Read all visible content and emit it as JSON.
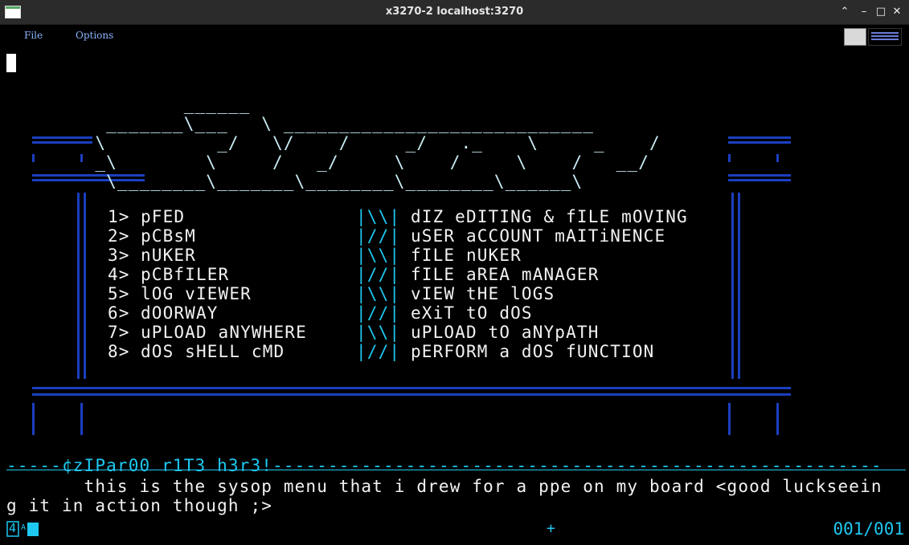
{
  "window": {
    "title": "x3270-2 localhost:3270"
  },
  "menubar": {
    "file": "File",
    "options": "Options"
  },
  "logo": [
    "                ______",
    "         _______\\___   \\ ____________________________",
    "        \\          _/   \\/    /     _/   ._    \\     _    /",
    "        _\\        \\     /   _/     \\    /     \\    /   __/",
    "         \\________\\_______\\________\\________\\______\\"
  ],
  "menu_items": [
    {
      "num": "1>",
      "name": "pFED",
      "sep": "|\\\\|",
      "desc": "dIZ eDITING & fILE mOVING"
    },
    {
      "num": "2>",
      "name": "pCBsM",
      "sep": "|//|",
      "desc": "uSER aCCOUNT mAITiNENCE"
    },
    {
      "num": "3>",
      "name": "nUKER",
      "sep": "|\\\\|",
      "desc": "fILE nUKER"
    },
    {
      "num": "4>",
      "name": "pCBfILER",
      "sep": "|//|",
      "desc": "fILE aREA mANAGER"
    },
    {
      "num": "5>",
      "name": "lOG vIEWER",
      "sep": "|\\\\|",
      "desc": "vIEW tHE lOGS"
    },
    {
      "num": "6>",
      "name": "dOORWAY",
      "sep": "|//|",
      "desc": "eXiT tO dOS"
    },
    {
      "num": "7>",
      "name": "uPLOAD aNYWHERE",
      "sep": "|\\\\|",
      "desc": "uPLOAD tO aNYpATH"
    },
    {
      "num": "8>",
      "name": "dOS sHELL cMD",
      "sep": "|//|",
      "desc": "pERFORM a dOS fUNCTION"
    }
  ],
  "footer": {
    "divider_label": "-----¢zIPar00 r1T3 h3r3!",
    "line1": "       this is the sysop menu that i drew for a ppe on my board <good luckseein",
    "line2": "g it in action though ;>"
  },
  "status": {
    "left": "4",
    "plus": "+",
    "position": "001/001"
  },
  "colors": {
    "accent": "#1ec8f0",
    "text": "#f2f2f2",
    "dots": "#1a3fc0",
    "menu": "#8ab4ff"
  }
}
